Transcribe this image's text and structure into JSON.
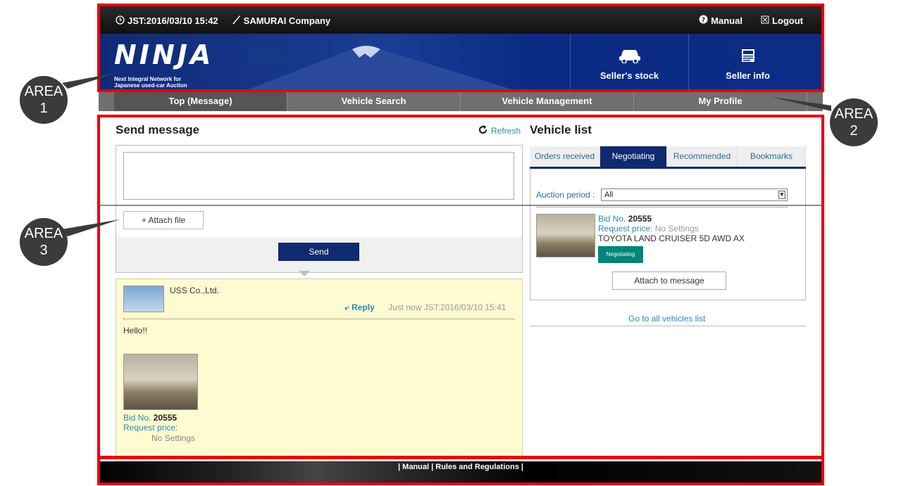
{
  "header": {
    "datetime": "JST:2016/03/10 15:42",
    "company": "SAMURAI Company",
    "manual_label": "Manual",
    "logout_label": "Logout"
  },
  "banner": {
    "logo": "NINJA",
    "logo_sub_line1": "Next Integral Network for",
    "logo_sub_line2": "Japanese used-car Auction",
    "stock_label": "Seller's stock",
    "info_label": "Seller info"
  },
  "nav": {
    "tabs": [
      "Top (Message)",
      "Vehicle Search",
      "Vehicle Management",
      "My Profile"
    ]
  },
  "message": {
    "title": "Send message",
    "refresh_label": "Refresh",
    "attach_label": "+ Attach file",
    "send_label": "Send"
  },
  "thread": {
    "sender": "USS Co.,Ltd.",
    "reply_label": "Reply",
    "time": "Just now JST:2016/03/10 15:41",
    "body": "Hello!!",
    "bid_label": "Bid No.",
    "bid_no": "20555",
    "request_label": "Request price:",
    "request_value": "No Settings"
  },
  "vehicle_list": {
    "title": "Vehicle list",
    "tabs": [
      "Orders received",
      "Negotiating",
      "Recommended",
      "Bookmarks"
    ],
    "auction_period_label": "Auction period :",
    "auction_period_value": "All",
    "bid_label": "Bid No.",
    "bid_no": "20555",
    "request_label": "Request price:",
    "request_value": "No Settings",
    "vehicle_name": "TOYOTA  LAND CRUISER 5D AWD  AX",
    "status_badge": "Negotiating",
    "attach_label": "Attach to message",
    "all_link": "Go to all vehicles list"
  },
  "footer": {
    "links": "| Manual | Rules and Regulations |"
  },
  "annotations": {
    "area1_line1": "AREA",
    "area1_line2": "1",
    "area2_line1": "AREA",
    "area2_line2": "2",
    "area3_line1": "AREA",
    "area3_line2": "3",
    "frame_color": "#e8000f"
  }
}
